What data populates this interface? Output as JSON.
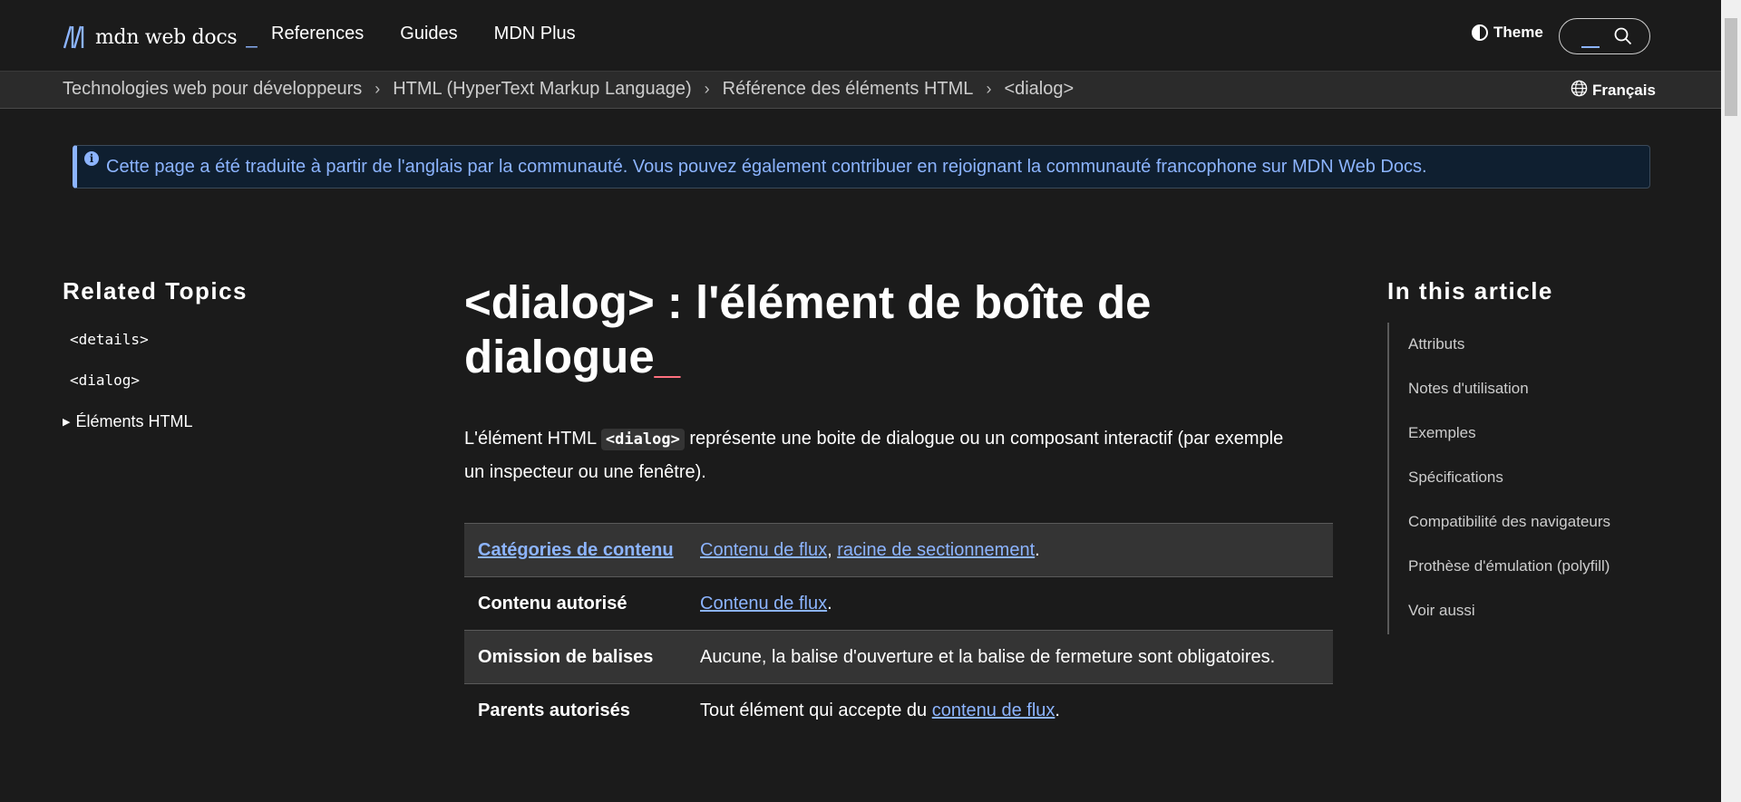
{
  "topnav": {
    "logo_text": "mdn web docs",
    "logo_underscore": "_",
    "links": [
      "References",
      "Guides",
      "MDN Plus"
    ],
    "theme_label": "Theme",
    "search_placeholder": ""
  },
  "breadcrumb": {
    "items": [
      "Technologies web pour développeurs",
      "HTML (HyperText Markup Language)",
      "Référence des éléments HTML",
      "<dialog>"
    ],
    "separator": "›",
    "language": "Français"
  },
  "notice": {
    "icon": "i",
    "text": "Cette page a été traduite à partir de l'anglais par la communauté. Vous pouvez également contribuer en rejoignant la communauté francophone sur MDN Web Docs."
  },
  "sidebar": {
    "title": "Related Topics",
    "items": [
      "<details>",
      "<dialog>"
    ],
    "toggle_label": "Éléments HTML",
    "toggle_icon": "▶"
  },
  "main": {
    "title": "<dialog> : l'élément de boîte de dialogue",
    "title_underscore": "_",
    "intro_before": "L'élément HTML ",
    "intro_code": "<dialog>",
    "intro_after": " représente une boite de dialogue ou un composant interactif (par exemple un inspecteur ou une fenêtre).",
    "table": {
      "row1": {
        "header": "Catégories de contenu",
        "link1": "Contenu de flux",
        "sep": ", ",
        "link2": "racine de sectionnement",
        "end": "."
      },
      "row2": {
        "header": "Contenu autorisé",
        "link1": "Contenu de flux",
        "end": "."
      },
      "row3": {
        "header": "Omission de balises",
        "text": "Aucune, la balise d'ouverture et la balise de fermeture sont obligatoires."
      },
      "row4": {
        "header": "Parents autorisés",
        "text": "Tout élément qui accepte du ",
        "link1": "contenu de flux",
        "end": "."
      }
    }
  },
  "toc": {
    "title": "In this article",
    "items": [
      "Attributs",
      "Notes d'utilisation",
      "Exemples",
      "Spécifications",
      "Compatibilité des navigateurs",
      "Prothèse d'émulation (polyfill)",
      "Voir aussi"
    ]
  },
  "colors": {
    "background": "#1b1b1b",
    "link": "#8cb4ff",
    "accent_underscore": "#ff707f",
    "table_row_alt": "#343434"
  }
}
